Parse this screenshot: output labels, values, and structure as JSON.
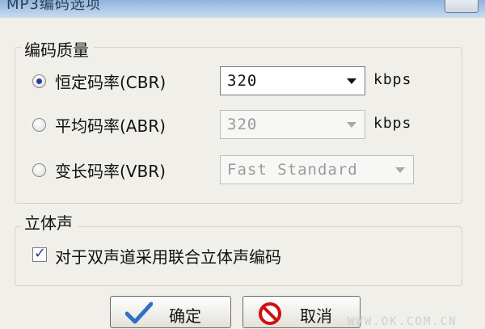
{
  "window": {
    "title": "MP3编码选项",
    "watermark": "WWW.OK.COM.CN"
  },
  "quality_group": {
    "legend": "编码质量",
    "rows": [
      {
        "label": "恒定码率(CBR)",
        "selected": true,
        "value": "320",
        "unit": "kbps",
        "enabled": true
      },
      {
        "label": "平均码率(ABR)",
        "selected": false,
        "value": "320",
        "unit": "kbps",
        "enabled": false
      },
      {
        "label": "变长码率(VBR)",
        "selected": false,
        "value": "Fast Standard",
        "unit": "",
        "enabled": false
      }
    ]
  },
  "stereo_group": {
    "legend": "立体声",
    "joint_stereo_label": "对于双声道采用联合立体声编码",
    "joint_stereo_checked": true
  },
  "buttons": {
    "ok_label": "确定",
    "cancel_label": "取消"
  },
  "icons": {
    "radio": "radio-button-icon",
    "dropdown": "chevron-down-icon",
    "check": "checkmark-icon",
    "ok": "green-checkmark-icon",
    "cancel": "no-entry-icon"
  },
  "colors": {
    "window_bg": "#f0efe9",
    "accent": "#2b3f9a",
    "ok_icon": "#2f6fc4",
    "cancel_icon": "#d01010"
  }
}
